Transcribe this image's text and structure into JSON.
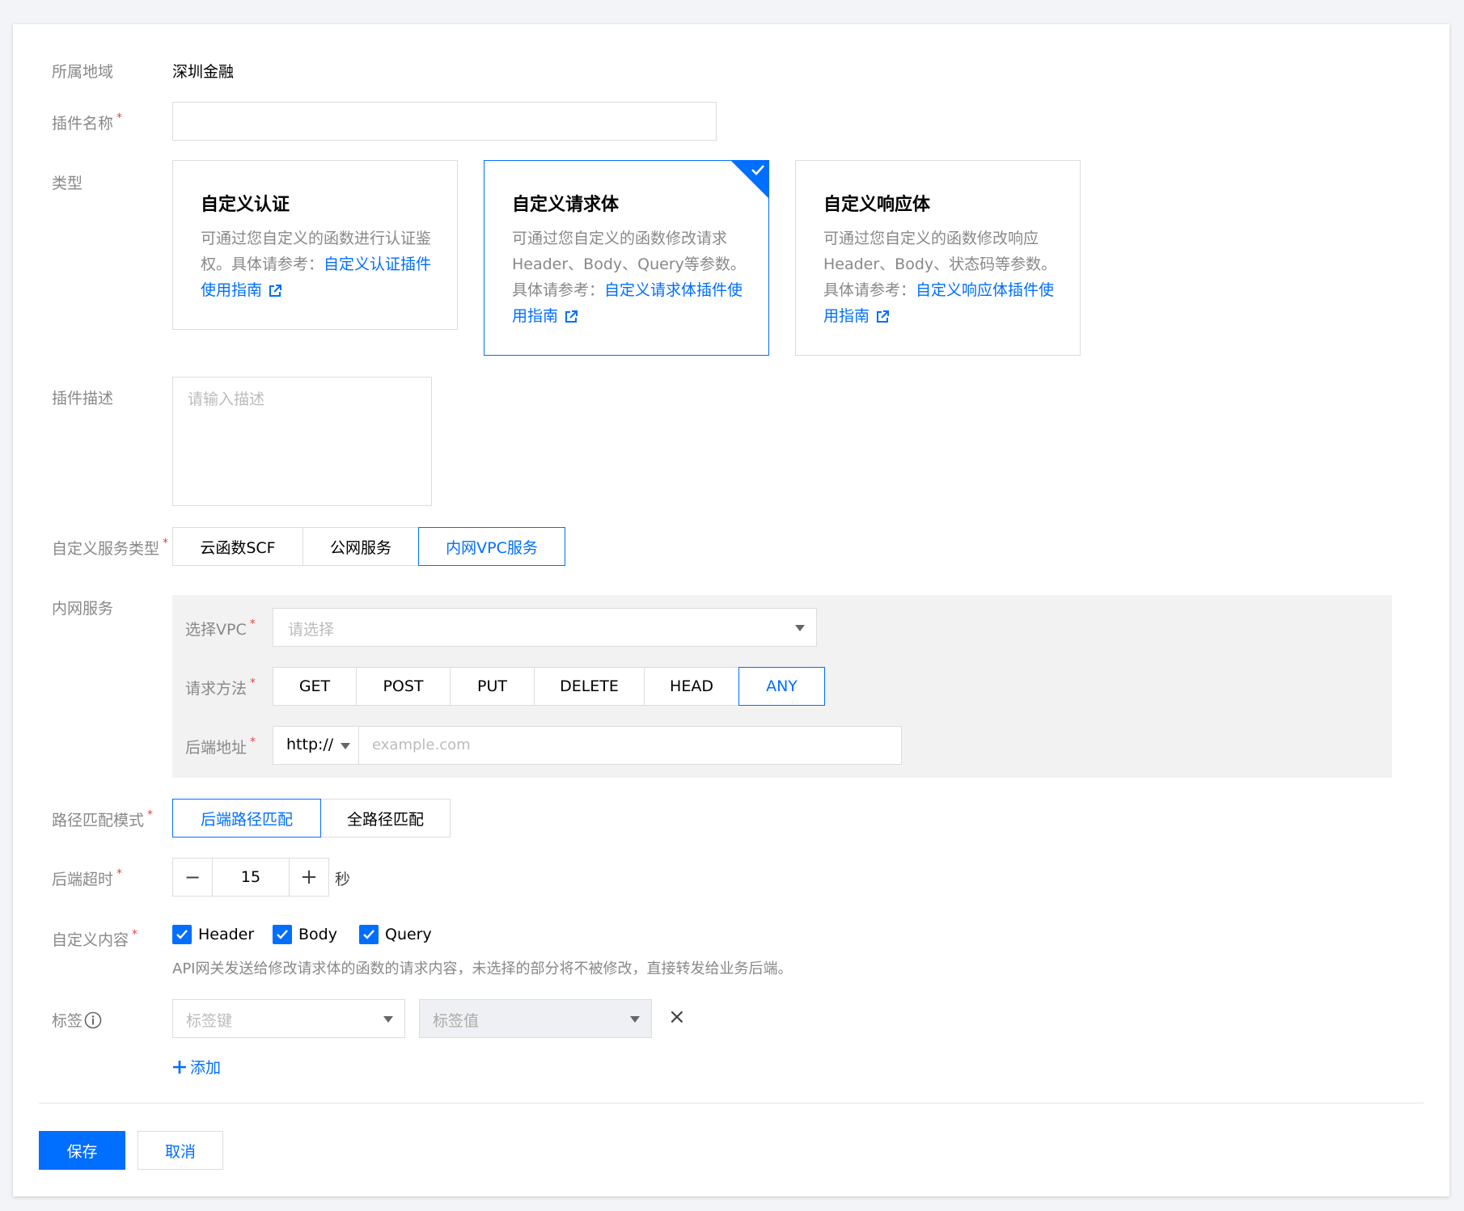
{
  "form": {
    "region": {
      "label": "所属地域",
      "value": "深圳金融"
    },
    "plugin_name": {
      "label": "插件名称",
      "required": "*",
      "value": ""
    },
    "type": {
      "label": "类型",
      "cards": [
        {
          "title": "自定义认证",
          "desc": "可通过您自定义的函数进行认证鉴权。具体请参考：",
          "link": "自定义认证插件使用指南",
          "selected": false
        },
        {
          "title": "自定义请求体",
          "desc": "可通过您自定义的函数修改请求Header、Body、Query等参数。具体请参考：",
          "link": "自定义请求体插件使用指南",
          "selected": true
        },
        {
          "title": "自定义响应体",
          "desc": "可通过您自定义的函数修改响应Header、Body、状态码等参数。具体请参考：",
          "link": "自定义响应体插件使用指南",
          "selected": false
        }
      ]
    },
    "description": {
      "label": "插件描述",
      "placeholder": "请输入描述"
    },
    "service_type": {
      "label": "自定义服务类型",
      "required": "*",
      "options": [
        "云函数SCF",
        "公网服务",
        "内网VPC服务"
      ],
      "selected": "内网VPC服务"
    },
    "vpc_service": {
      "label": "内网服务",
      "vpc": {
        "label": "选择VPC",
        "required": "*",
        "placeholder": "请选择"
      },
      "method": {
        "label": "请求方法",
        "required": "*",
        "options": [
          "GET",
          "POST",
          "PUT",
          "DELETE",
          "HEAD",
          "ANY"
        ],
        "selected": "ANY"
      },
      "backend": {
        "label": "后端地址",
        "required": "*",
        "protocol": "http://",
        "placeholder": "example.com"
      }
    },
    "path_match": {
      "label": "路径匹配模式",
      "required": "*",
      "options": [
        "后端路径匹配",
        "全路径匹配"
      ],
      "selected": "后端路径匹配"
    },
    "timeout": {
      "label": "后端超时",
      "required": "*",
      "value": "15",
      "unit": "秒",
      "minus": "−",
      "plus": "+"
    },
    "custom_content": {
      "label": "自定义内容",
      "required": "*",
      "options": [
        {
          "label": "Header",
          "checked": true
        },
        {
          "label": "Body",
          "checked": true
        },
        {
          "label": "Query",
          "checked": true
        }
      ],
      "hint": "API网关发送给修改请求体的函数的请求内容，未选择的部分将不被修改，直接转发给业务后端。"
    },
    "tags": {
      "label": "标签",
      "key_placeholder": "标签键",
      "value_placeholder": "标签值",
      "add_label": "添加",
      "remove": "×"
    }
  },
  "footer": {
    "save": "保存",
    "cancel": "取消"
  },
  "colors": {
    "primary": "#006eff",
    "required": "#e54545",
    "label": "#888888",
    "border": "#dcdcdc"
  },
  "icons": [
    "external-link-icon",
    "check-icon",
    "caret-down-icon",
    "info-icon",
    "close-icon",
    "plus-icon"
  ]
}
